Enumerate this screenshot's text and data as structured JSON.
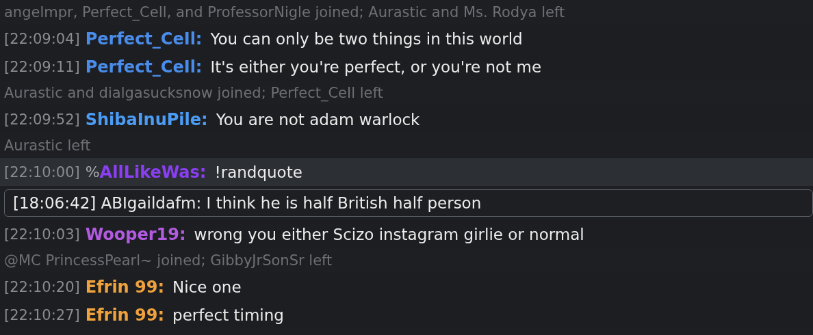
{
  "lines": [
    {
      "kind": "notice",
      "text": "angelmpr, Perfect_CeIl, and ProfessorNigle joined; Aurastic and Ms. Rodya left"
    },
    {
      "kind": "message",
      "time": "[22:09:04]",
      "name": "Perfect_CeIl:",
      "color": "#4a8cea",
      "text": "You can only be two things in this world",
      "highlighted": false
    },
    {
      "kind": "message",
      "time": "[22:09:11]",
      "name": "Perfect_CeIl:",
      "color": "#4a8cea",
      "text": "It's either you're perfect, or you're not me",
      "highlighted": false
    },
    {
      "kind": "notice",
      "text": "Aurastic and dialgasucksnow joined; Perfect_CeIl left"
    },
    {
      "kind": "message",
      "time": "[22:09:52]",
      "name": "ShibaInuPile:",
      "color": "#4b9cf5",
      "text": "You are not adam warlock",
      "highlighted": false
    },
    {
      "kind": "notice",
      "text": "Aurastic left"
    },
    {
      "kind": "message",
      "time": "[22:10:00]",
      "rank": "%",
      "name": "AllLikeWas:",
      "color": "#8a3ff2",
      "text": "!randquote",
      "highlighted": true
    },
    {
      "kind": "quote",
      "text": "[18:06:42] ABIgaildafm: I think he is half British half person"
    },
    {
      "kind": "message",
      "time": "[22:10:03]",
      "name": "Wooper19:",
      "color": "#b25ae0",
      "text": "wrong you either Scizo instagram girlie or normal",
      "highlighted": false
    },
    {
      "kind": "notice",
      "text": "@MC PrincessPearl~ joined; GibbyJrSonSr left"
    },
    {
      "kind": "message",
      "time": "[22:10:20]",
      "name": "Efrin 99:",
      "color": "#f0a23c",
      "text": "Nice one",
      "highlighted": false
    },
    {
      "kind": "message",
      "time": "[22:10:27]",
      "name": "Efrin 99:",
      "color": "#f0a23c",
      "text": "perfect timing",
      "highlighted": false
    }
  ]
}
